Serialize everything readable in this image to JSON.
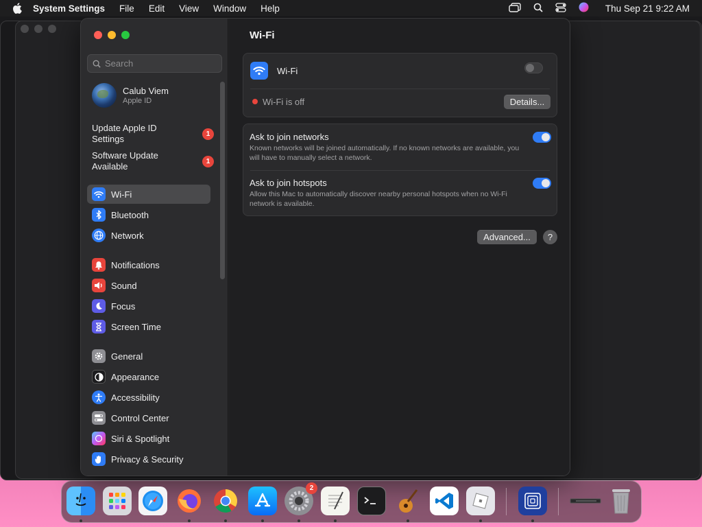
{
  "menubar": {
    "apple_icon": "apple-logo-icon",
    "app_name": "System Settings",
    "menus": [
      "File",
      "Edit",
      "View",
      "Window",
      "Help"
    ],
    "status_icons": [
      "window-stack-icon",
      "search-icon",
      "control-center-icon",
      "siri-icon"
    ],
    "clock": "Thu Sep 21  9:22 AM"
  },
  "sidebar": {
    "search_placeholder": "Search",
    "profile": {
      "name": "Calub Viem",
      "subtitle": "Apple ID"
    },
    "alerts": [
      {
        "label": "Update Apple ID Settings",
        "badge": "1"
      },
      {
        "label": "Software Update Available",
        "badge": "1"
      }
    ],
    "groups": [
      [
        {
          "label": "Wi-Fi",
          "icon": "wifi-icon",
          "color": "#2f7cf6",
          "selected": true
        },
        {
          "label": "Bluetooth",
          "icon": "bluetooth-icon",
          "color": "#2f7cf6"
        },
        {
          "label": "Network",
          "icon": "globe-icon",
          "color": "#2f7cf6"
        }
      ],
      [
        {
          "label": "Notifications",
          "icon": "bell-icon",
          "color": "#e8453c"
        },
        {
          "label": "Sound",
          "icon": "speaker-icon",
          "color": "#e8453c"
        },
        {
          "label": "Focus",
          "icon": "moon-icon",
          "color": "#5e5ce6"
        },
        {
          "label": "Screen Time",
          "icon": "hourglass-icon",
          "color": "#5e5ce6"
        }
      ],
      [
        {
          "label": "General",
          "icon": "gear-icon",
          "color": "#8e8e93"
        },
        {
          "label": "Appearance",
          "icon": "appearance-icon",
          "color": "#1c1c1e"
        },
        {
          "label": "Accessibility",
          "icon": "accessibility-icon",
          "color": "#2f7cf6"
        },
        {
          "label": "Control Center",
          "icon": "toggles-icon",
          "color": "#8e8e93"
        },
        {
          "label": "Siri & Spotlight",
          "icon": "siri-icon",
          "color": "#b14cd6"
        },
        {
          "label": "Privacy & Security",
          "icon": "hand-icon",
          "color": "#2f7cf6"
        }
      ]
    ]
  },
  "content": {
    "title": "Wi-Fi",
    "wifi": {
      "label": "Wi-Fi",
      "enabled": false,
      "status": "Wi-Fi is off",
      "status_color": "#e8453c",
      "details_button": "Details..."
    },
    "options": [
      {
        "title": "Ask to join networks",
        "description": "Known networks will be joined automatically. If no known networks are available, you will have to manually select a network.",
        "enabled": true
      },
      {
        "title": "Ask to join hotspots",
        "description": "Allow this Mac to automatically discover nearby personal hotspots when no Wi-Fi network is available.",
        "enabled": true
      }
    ],
    "advanced_button": "Advanced...",
    "help_button": "?"
  },
  "dock": {
    "apps": [
      {
        "name": "finder-icon",
        "running": true
      },
      {
        "name": "launchpad-icon",
        "running": false
      },
      {
        "name": "safari-icon",
        "running": false
      },
      {
        "name": "firefox-icon",
        "running": true
      },
      {
        "name": "chrome-icon",
        "running": true
      },
      {
        "name": "app-store-icon",
        "running": true
      },
      {
        "name": "system-settings-icon",
        "running": true,
        "badge": "2"
      },
      {
        "name": "textedit-icon",
        "running": true
      },
      {
        "name": "terminal-icon",
        "running": false
      },
      {
        "name": "garageband-icon",
        "running": true
      },
      {
        "name": "vscode-icon",
        "running": false
      },
      {
        "name": "roblox-icon",
        "running": true
      },
      {
        "name": "screen-sharing-icon",
        "running": true
      },
      {
        "name": "minimized-window-icon",
        "running": false
      },
      {
        "name": "trash-icon",
        "running": false
      }
    ]
  }
}
